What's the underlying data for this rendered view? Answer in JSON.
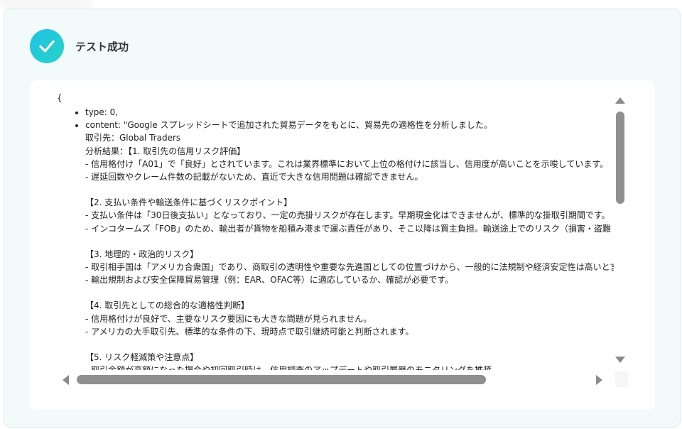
{
  "result": {
    "title": "テスト成功",
    "status_color": "#1fc2e8"
  },
  "content": {
    "open_brace": "{",
    "items": [
      "type: 0,",
      "content: \"Google スプレッドシートで追加された貿易データをもとに、貿易先の適格性を分析しました。"
    ],
    "lines": [
      "取引先：Global Traders",
      "分析結果：【1. 取引先の信用リスク評価】",
      "- 信用格付け「A01」で「良好」とされています。これは業界標準において上位の格付けに該当し、信用度が高いことを示唆しています。",
      "- 遅延回数やクレーム件数の記載がないため、直近で大きな信用問題は確認できません。",
      "",
      "【2. 支払い条件や輸送条件に基づくリスクポイント】",
      "- 支払い条件は「30日後支払い」となっており、一定の売掛リスクが存在します。早期現金化はできませんが、標準的な掛取引期間です。",
      "- インコタームズ「FOB」のため、輸出者が貨物を船積み港まで運ぶ責任があり、そこ以降は買主負担。輸送途上でのリスク（損害・盗難・遅延",
      "",
      "【3. 地理的・政治的リスク】",
      "- 取引相手国は「アメリカ合衆国」であり、商取引の透明性や重要な先進国としての位置づけから、一般的に法規制や経済安定性は高いと言",
      "- 輸出規制および安全保障貿易管理（例：EAR、OFAC等）に適応しているか、確認が必要です。",
      "",
      "【4. 取引先としての総合的な適格性判断】",
      "- 信用格付けが良好で、主要なリスク要因にも大きな問題が見られません。",
      "- アメリカの大手取引先、標準的な条件の下、現時点で取引継続可能と判断されます。",
      "",
      "【5. リスク軽減策や注意点】",
      "- 取引金額が高額になった場合や初回取引時は、信用調査のアップデートや取引履歴のモニタリングを推奨"
    ]
  },
  "scroll": {
    "vertical_position": 0.05,
    "horizontal_position": 0.0
  }
}
